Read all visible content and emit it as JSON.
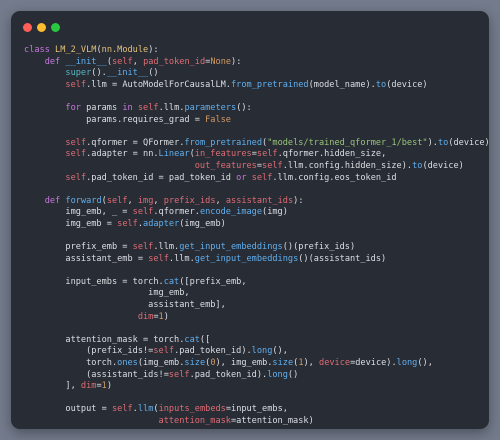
{
  "window": {
    "controls": [
      {
        "name": "close",
        "color": "#ff5f57"
      },
      {
        "name": "minimize",
        "color": "#febc2e"
      },
      {
        "name": "maximize",
        "color": "#28c840"
      }
    ]
  },
  "code": {
    "language": "python",
    "lines": [
      [
        [
          "kw",
          "class "
        ],
        [
          "cls",
          "LM_2_VLM"
        ],
        [
          "tx",
          "("
        ],
        [
          "cls",
          "nn.Module"
        ],
        [
          "tx",
          "):"
        ]
      ],
      [
        [
          "tx",
          "    "
        ],
        [
          "kw",
          "def "
        ],
        [
          "fn",
          "__init__"
        ],
        [
          "tx",
          "("
        ],
        [
          "self",
          "self"
        ],
        [
          "tx",
          ", "
        ],
        [
          "self",
          "pad_token_id"
        ],
        [
          "tx",
          "="
        ],
        [
          "num",
          "None"
        ],
        [
          "tx",
          "):"
        ]
      ],
      [
        [
          "tx",
          "        "
        ],
        [
          "bi",
          "super"
        ],
        [
          "tx",
          "()."
        ],
        [
          "fn",
          "__init__"
        ],
        [
          "tx",
          "()"
        ]
      ],
      [
        [
          "tx",
          "        "
        ],
        [
          "self",
          "self"
        ],
        [
          "tx",
          ".llm = AutoModelForCausalLM."
        ],
        [
          "fn",
          "from_pretrained"
        ],
        [
          "tx",
          "(model_name)."
        ],
        [
          "fn",
          "to"
        ],
        [
          "tx",
          "(device)"
        ]
      ],
      [],
      [
        [
          "tx",
          "        "
        ],
        [
          "kw",
          "for "
        ],
        [
          "tx",
          "params "
        ],
        [
          "kw",
          "in "
        ],
        [
          "self",
          "self"
        ],
        [
          "tx",
          ".llm."
        ],
        [
          "fn",
          "parameters"
        ],
        [
          "tx",
          "():"
        ]
      ],
      [
        [
          "tx",
          "            params.requires_grad = "
        ],
        [
          "num",
          "False"
        ]
      ],
      [],
      [
        [
          "tx",
          "        "
        ],
        [
          "self",
          "self"
        ],
        [
          "tx",
          ".qformer = QFormer."
        ],
        [
          "fn",
          "from_pretrained"
        ],
        [
          "tx",
          "("
        ],
        [
          "str",
          "\"models/trained_qformer_1/best\""
        ],
        [
          "tx",
          ")."
        ],
        [
          "fn",
          "to"
        ],
        [
          "tx",
          "(device)"
        ]
      ],
      [
        [
          "tx",
          "        "
        ],
        [
          "self",
          "self"
        ],
        [
          "tx",
          ".adapter = nn."
        ],
        [
          "fn",
          "Linear"
        ],
        [
          "tx",
          "("
        ],
        [
          "self",
          "in_features"
        ],
        [
          "tx",
          "="
        ],
        [
          "self",
          "self"
        ],
        [
          "tx",
          ".qformer.hidden_size,"
        ]
      ],
      [
        [
          "tx",
          "                                 "
        ],
        [
          "self",
          "out_features"
        ],
        [
          "tx",
          "="
        ],
        [
          "self",
          "self"
        ],
        [
          "tx",
          ".llm.config.hidden_size)."
        ],
        [
          "fn",
          "to"
        ],
        [
          "tx",
          "(device)"
        ]
      ],
      [
        [
          "tx",
          "        "
        ],
        [
          "self",
          "self"
        ],
        [
          "tx",
          ".pad_token_id = pad_token_id "
        ],
        [
          "kw",
          "or "
        ],
        [
          "self",
          "self"
        ],
        [
          "tx",
          ".llm.config.eos_token_id"
        ]
      ],
      [],
      [
        [
          "tx",
          "    "
        ],
        [
          "kw",
          "def "
        ],
        [
          "fn",
          "forward"
        ],
        [
          "tx",
          "("
        ],
        [
          "self",
          "self"
        ],
        [
          "tx",
          ", "
        ],
        [
          "self",
          "img"
        ],
        [
          "tx",
          ", "
        ],
        [
          "self",
          "prefix_ids"
        ],
        [
          "tx",
          ", "
        ],
        [
          "self",
          "assistant_ids"
        ],
        [
          "tx",
          "):"
        ]
      ],
      [
        [
          "tx",
          "        img_emb, _ = "
        ],
        [
          "self",
          "self"
        ],
        [
          "tx",
          ".qformer."
        ],
        [
          "fn",
          "encode_image"
        ],
        [
          "tx",
          "(img)"
        ]
      ],
      [
        [
          "tx",
          "        img_emb = "
        ],
        [
          "self",
          "self"
        ],
        [
          "tx",
          "."
        ],
        [
          "fn",
          "adapter"
        ],
        [
          "tx",
          "(img_emb)"
        ]
      ],
      [],
      [
        [
          "tx",
          "        prefix_emb = "
        ],
        [
          "self",
          "self"
        ],
        [
          "tx",
          ".llm."
        ],
        [
          "fn",
          "get_input_embeddings"
        ],
        [
          "tx",
          "()(prefix_ids)"
        ]
      ],
      [
        [
          "tx",
          "        assistant_emb = "
        ],
        [
          "self",
          "self"
        ],
        [
          "tx",
          ".llm."
        ],
        [
          "fn",
          "get_input_embeddings"
        ],
        [
          "tx",
          "()(assistant_ids)"
        ]
      ],
      [],
      [
        [
          "tx",
          "        input_embs = torch."
        ],
        [
          "fn",
          "cat"
        ],
        [
          "tx",
          "([prefix_emb,"
        ]
      ],
      [
        [
          "tx",
          "                        img_emb,"
        ]
      ],
      [
        [
          "tx",
          "                        assistant_emb],"
        ]
      ],
      [
        [
          "tx",
          "                      "
        ],
        [
          "self",
          "dim"
        ],
        [
          "tx",
          "="
        ],
        [
          "num",
          "1"
        ],
        [
          "tx",
          ")"
        ]
      ],
      [],
      [
        [
          "tx",
          "        attention_mask = torch."
        ],
        [
          "fn",
          "cat"
        ],
        [
          "tx",
          "(["
        ]
      ],
      [
        [
          "tx",
          "            (prefix_ids!="
        ],
        [
          "self",
          "self"
        ],
        [
          "tx",
          ".pad_token_id)."
        ],
        [
          "fn",
          "long"
        ],
        [
          "tx",
          "(),"
        ]
      ],
      [
        [
          "tx",
          "            torch."
        ],
        [
          "fn",
          "ones"
        ],
        [
          "tx",
          "(img_emb."
        ],
        [
          "fn",
          "size"
        ],
        [
          "tx",
          "("
        ],
        [
          "num",
          "0"
        ],
        [
          "tx",
          "), img_emb."
        ],
        [
          "fn",
          "size"
        ],
        [
          "tx",
          "("
        ],
        [
          "num",
          "1"
        ],
        [
          "tx",
          "), "
        ],
        [
          "self",
          "device"
        ],
        [
          "tx",
          "=device)."
        ],
        [
          "fn",
          "long"
        ],
        [
          "tx",
          "(),"
        ]
      ],
      [
        [
          "tx",
          "            (assistant_ids!="
        ],
        [
          "self",
          "self"
        ],
        [
          "tx",
          ".pad_token_id)."
        ],
        [
          "fn",
          "long"
        ],
        [
          "tx",
          "()"
        ]
      ],
      [
        [
          "tx",
          "        ], "
        ],
        [
          "self",
          "dim"
        ],
        [
          "tx",
          "="
        ],
        [
          "num",
          "1"
        ],
        [
          "tx",
          ")"
        ]
      ],
      [],
      [
        [
          "tx",
          "        output = "
        ],
        [
          "self",
          "self"
        ],
        [
          "tx",
          "."
        ],
        [
          "fn",
          "llm"
        ],
        [
          "tx",
          "("
        ],
        [
          "self",
          "inputs_embeds"
        ],
        [
          "tx",
          "=input_embs,"
        ]
      ],
      [
        [
          "tx",
          "                          "
        ],
        [
          "self",
          "attention_mask"
        ],
        [
          "tx",
          "=attention_mask)"
        ]
      ],
      [
        [
          "tx",
          "        ..."
        ]
      ]
    ]
  }
}
